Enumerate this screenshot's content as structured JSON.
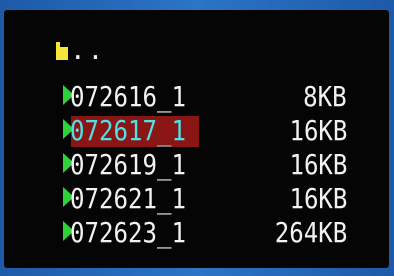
{
  "parent_entry": {
    "label": "..",
    "icon": "folder-up-icon",
    "icon_color": "#f5e63a"
  },
  "files": [
    {
      "name": "072616_1",
      "size": "8KB",
      "selected": false
    },
    {
      "name": "072617_1",
      "size": "16KB",
      "selected": true
    },
    {
      "name": "072619_1",
      "size": "16KB",
      "selected": false
    },
    {
      "name": "072621_1",
      "size": "16KB",
      "selected": false
    },
    {
      "name": "072623_1",
      "size": "264KB",
      "selected": false
    }
  ],
  "colors": {
    "background": "#050505",
    "frame": "#2c74c7",
    "text": "#f2f2f2",
    "selected_text": "#4fe0e8",
    "selected_background": "#8a1515",
    "arrow": "#2fd23a"
  }
}
